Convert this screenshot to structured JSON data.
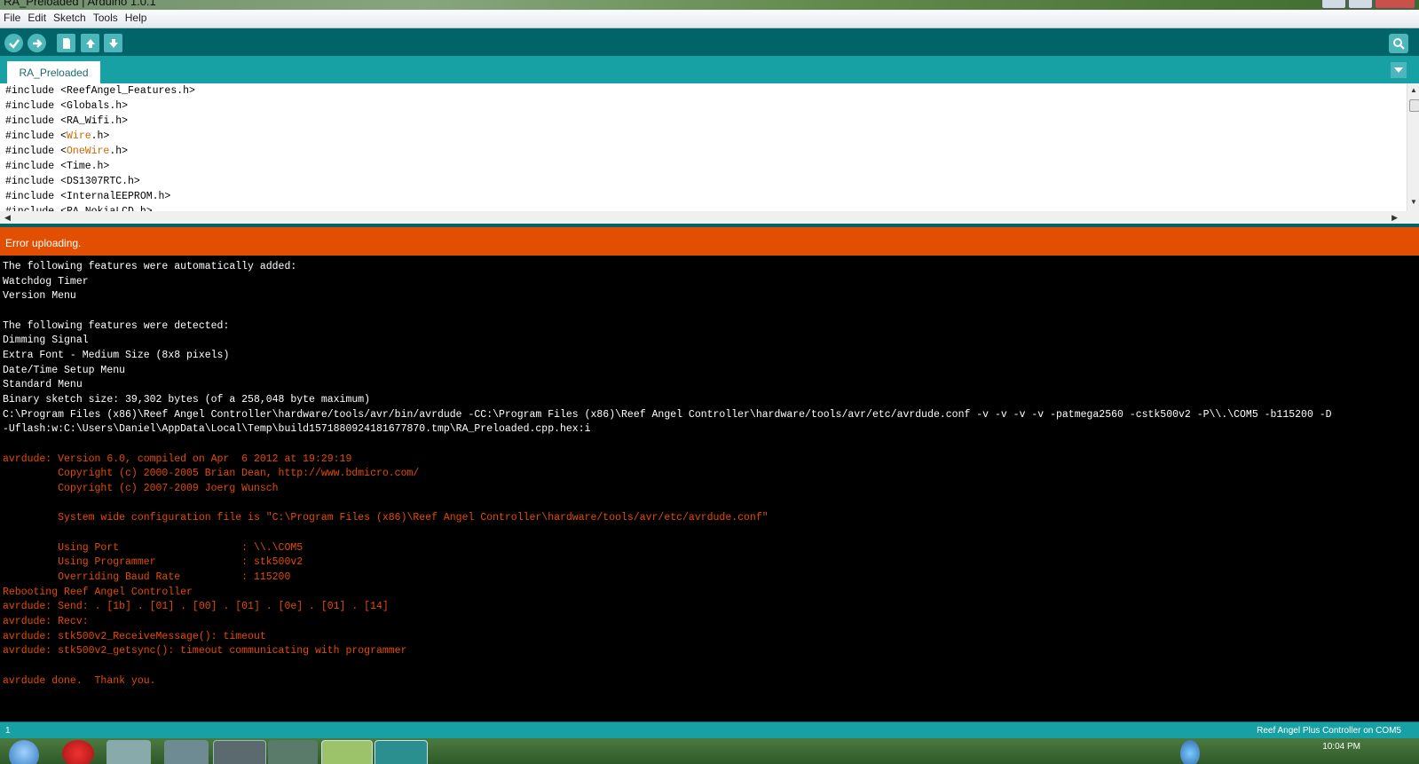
{
  "window": {
    "title": "RA_Preloaded | Arduino 1.0.1"
  },
  "menu": [
    "File",
    "Edit",
    "Sketch",
    "Tools",
    "Help"
  ],
  "toolbar": {
    "buttons": [
      "verify-icon",
      "upload-icon",
      "new-icon",
      "open-icon",
      "save-icon"
    ],
    "serial_monitor": "serial-monitor-icon"
  },
  "tab": {
    "name": "RA_Preloaded"
  },
  "editor": {
    "lines": [
      "#include <ReefAngel_Features.h>",
      "#include <Globals.h>",
      "#include <RA_Wifi.h>",
      "#include <",
      "#include <",
      "#include <Time.h>",
      "#include <DS1307RTC.h>",
      "#include <InternalEEPROM.h>",
      "#include <RA_NokiaLCD.h>"
    ],
    "wire_kw": "Wire",
    "wire_rest": ".h>",
    "onewire_kw": "OneWire",
    "onewire_rest": ".h>"
  },
  "status": {
    "message": "Error uploading."
  },
  "console": {
    "white_lines": [
      "The following features were automatically added:",
      "Watchdog Timer",
      "Version Menu",
      "",
      "The following features were detected:",
      "Dimming Signal",
      "Extra Font - Medium Size (8x8 pixels)",
      "Date/Time Setup Menu",
      "Standard Menu",
      "Binary sketch size: 39,302 bytes (of a 258,048 byte maximum)",
      "C:\\Program Files (x86)\\Reef Angel Controller\\hardware/tools/avr/bin/avrdude -CC:\\Program Files (x86)\\Reef Angel Controller\\hardware/tools/avr/etc/avrdude.conf -v -v -v -v -patmega2560 -cstk500v2 -P\\\\.\\COM5 -b115200 -D",
      "-Uflash:w:C:\\Users\\Daniel\\AppData\\Local\\Temp\\build1571880924181677870.tmp\\RA_Preloaded.cpp.hex:i"
    ],
    "orange_lines": [
      "",
      "avrdude: Version 6.0, compiled on Apr  6 2012 at 19:29:19",
      "         Copyright (c) 2000-2005 Brian Dean, http://www.bdmicro.com/",
      "         Copyright (c) 2007-2009 Joerg Wunsch",
      "",
      "         System wide configuration file is \"C:\\Program Files (x86)\\Reef Angel Controller\\hardware/tools/avr/etc/avrdude.conf\"",
      "",
      "         Using Port                    : \\\\.\\COM5",
      "         Using Programmer              : stk500v2",
      "         Overriding Baud Rate          : 115200",
      "Rebooting Reef Angel Controller",
      "avrdude: Send: . [1b] . [01] . [00] . [01] . [0e] . [01] . [14]",
      "avrdude: Recv:",
      "avrdude: stk500v2_ReceiveMessage(): timeout",
      "avrdude: stk500v2_getsync(): timeout communicating with programmer",
      "",
      "avrdude done.  Thank you."
    ]
  },
  "footer": {
    "line_number": "1",
    "board": "Reef Angel Plus Controller on COM5"
  },
  "taskbar": {
    "clock": "10:04 PM"
  }
}
